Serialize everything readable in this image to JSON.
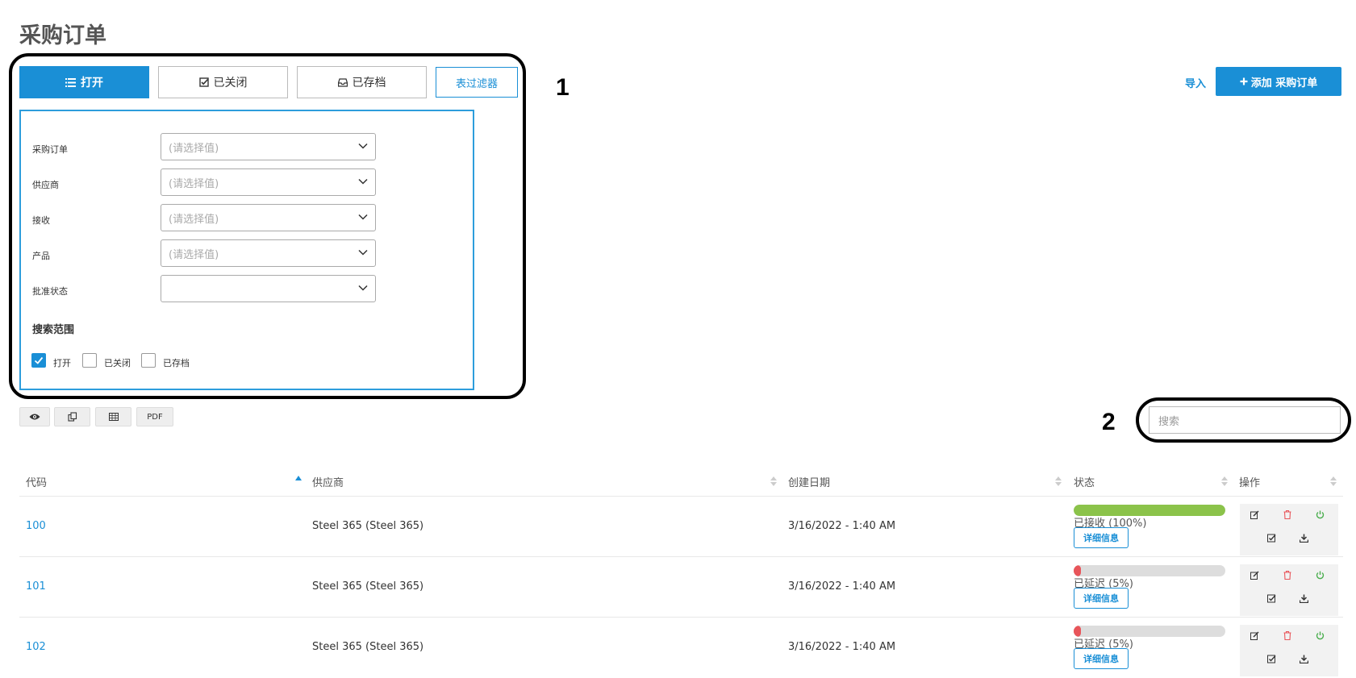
{
  "page": {
    "title": "采购订单"
  },
  "tabs": [
    {
      "label": "打开",
      "icon": "list-icon",
      "active": true
    },
    {
      "label": "已关闭",
      "icon": "check-square-icon",
      "active": false
    },
    {
      "label": "已存档",
      "icon": "archive-icon",
      "active": false
    }
  ],
  "filter_toggle": {
    "label": "表过滤器"
  },
  "filters": [
    {
      "label": "采购订单",
      "placeholder": "(请选择值)"
    },
    {
      "label": "供应商",
      "placeholder": "(请选择值)"
    },
    {
      "label": "接收",
      "placeholder": "(请选择值)"
    },
    {
      "label": "产品",
      "placeholder": "(请选择值)"
    },
    {
      "label": "批准状态",
      "placeholder": ""
    }
  ],
  "search_scope": {
    "title": "搜索范围",
    "options": [
      {
        "label": "打开",
        "checked": true
      },
      {
        "label": "已关闭",
        "checked": false
      },
      {
        "label": "已存档",
        "checked": false
      }
    ]
  },
  "annotations": {
    "one": "1",
    "two": "2"
  },
  "actions": {
    "import_label": "导入",
    "add_label": "添加 采购订单"
  },
  "toolbar": {
    "pdf_label": "PDF"
  },
  "search": {
    "placeholder": "搜索"
  },
  "table": {
    "columns": [
      "代码",
      "供应商",
      "创建日期",
      "状态",
      "操作"
    ],
    "rows": [
      {
        "code": "100",
        "supplier": "Steel 365 (Steel 365)",
        "created": "3/16/2022 - 1:40 AM",
        "status": "已接收 (100%)",
        "progress": 1.0,
        "color": "#8bc34a",
        "detail": "详细信息"
      },
      {
        "code": "101",
        "supplier": "Steel 365 (Steel 365)",
        "created": "3/16/2022 - 1:40 AM",
        "status": "已延迟 (5%)",
        "progress": 0.05,
        "color": "#e8555a",
        "detail": "详细信息"
      },
      {
        "code": "102",
        "supplier": "Steel 365 (Steel 365)",
        "created": "3/16/2022 - 1:40 AM",
        "status": "已延迟 (5%)",
        "progress": 0.05,
        "color": "#e8555a",
        "detail": "详细信息"
      }
    ]
  },
  "colors": {
    "accent": "#1a8fd6",
    "success": "#8bc34a",
    "danger": "#e8555a"
  }
}
